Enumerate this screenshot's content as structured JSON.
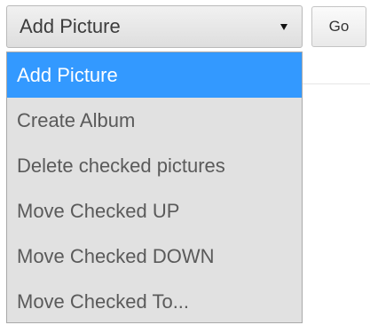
{
  "select": {
    "selected_label": "Add Picture",
    "options": [
      {
        "label": "Add Picture",
        "highlighted": true
      },
      {
        "label": "Create Album",
        "highlighted": false
      },
      {
        "label": "Delete checked pictures",
        "highlighted": false
      },
      {
        "label": "Move Checked UP",
        "highlighted": false
      },
      {
        "label": "Move Checked DOWN",
        "highlighted": false
      },
      {
        "label": "Move Checked To...",
        "highlighted": false
      }
    ]
  },
  "go_button": {
    "label": "Go"
  },
  "colors": {
    "highlight": "#3399ff",
    "highlight_text": "#ffffff",
    "list_background": "#e1e1e1",
    "option_text": "#5a5a5a"
  }
}
